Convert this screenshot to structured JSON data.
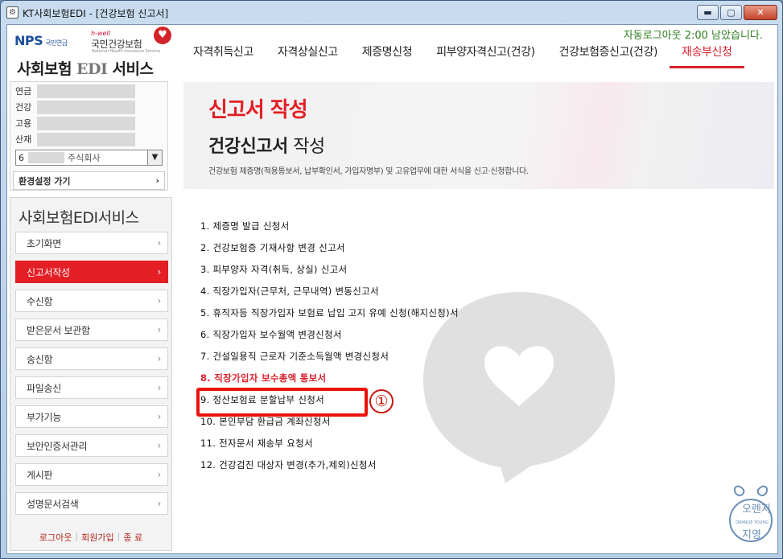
{
  "window": {
    "title": "KT사회보험EDI - [건강보험 신고서]",
    "buttons": [
      "minimize",
      "maximize",
      "close"
    ]
  },
  "header": {
    "nps_logo": "NPS",
    "nps_sub": "국민연금",
    "hwell": "h-well",
    "nhis_logo": "국민건강보험",
    "nhis_sub": "National Health Insurance Service",
    "service_title_a": "사회보험 ",
    "service_title_b": "EDI",
    "service_title_c": " 서비스",
    "auto_logout": "자동로그아웃 2:00 남았습니다.",
    "nav": [
      {
        "label": "자격취득신고",
        "active": false
      },
      {
        "label": "자격상실신고",
        "active": false
      },
      {
        "label": "제증명신청",
        "active": false
      },
      {
        "label": "피부양자격신고(건강)",
        "active": false
      },
      {
        "label": "건강보험증신고(건강)",
        "active": false
      },
      {
        "label": "재송부신청",
        "active": true
      }
    ]
  },
  "user": {
    "rows": [
      "연금",
      "건강",
      "고용",
      "산재"
    ],
    "company_prefix": "6",
    "company_name": "주식회사",
    "settings_button": "환경설정 가기"
  },
  "sidebar": {
    "title": "사회보험EDI서비스",
    "items": [
      {
        "label": "초기화면",
        "active": false
      },
      {
        "label": "신고서작성",
        "active": true
      },
      {
        "label": "수신함",
        "active": false
      },
      {
        "label": "받은문서 보관함",
        "active": false
      },
      {
        "label": "송신함",
        "active": false
      },
      {
        "label": "파일송신",
        "active": false
      },
      {
        "label": "부가기능",
        "active": false
      },
      {
        "label": "보안인증서관리",
        "active": false
      },
      {
        "label": "게시판",
        "active": false
      },
      {
        "label": "성명문서검색",
        "active": false
      }
    ],
    "footer": [
      "로그아웃",
      "회원가입",
      "종 료"
    ]
  },
  "banner": {
    "heading": "신고서 작성",
    "sub_bold": "건강신고서",
    "sub_rest": " 작성",
    "description": "건강보험 제증명(적용통보서, 납부확인서, 가입자명부) 및 고유업무에 대한 서식을 신고·신청합니다."
  },
  "forms": [
    "1. 제증명 발급 신청서",
    "2. 건강보험증 기재사항 변경 신고서",
    "3. 피부양자 자격(취득, 상실) 신고서",
    "4. 직장가입자(근무처, 근무내역) 변동신고서",
    "5. 휴직자등 직장가입자 보험료 납입 고지 유예 신청(해지신청)서",
    "6. 직장가입자 보수월액 변경신청서",
    "7. 건설일용직 근로자 기준소득월액 변경신청서",
    "8. 직장가입자 보수총액 통보서",
    "9. 정산보험료 분할납부 신청서",
    "10. 본인부담 환급금 계좌신청서",
    "11. 전자문서 재송부 요청서",
    "12. 건강검진 대상자 변경(추가,제외)신청서"
  ],
  "highlighted_form_index": 7,
  "step_marker": "①",
  "emblem": {
    "top": "오렌지",
    "bottom": "지영",
    "ring": "ORANGE YOUNG"
  },
  "colors": {
    "accent": "#e31e25",
    "autologout": "#2e7d1f",
    "highlight_box": "#e8140c"
  }
}
